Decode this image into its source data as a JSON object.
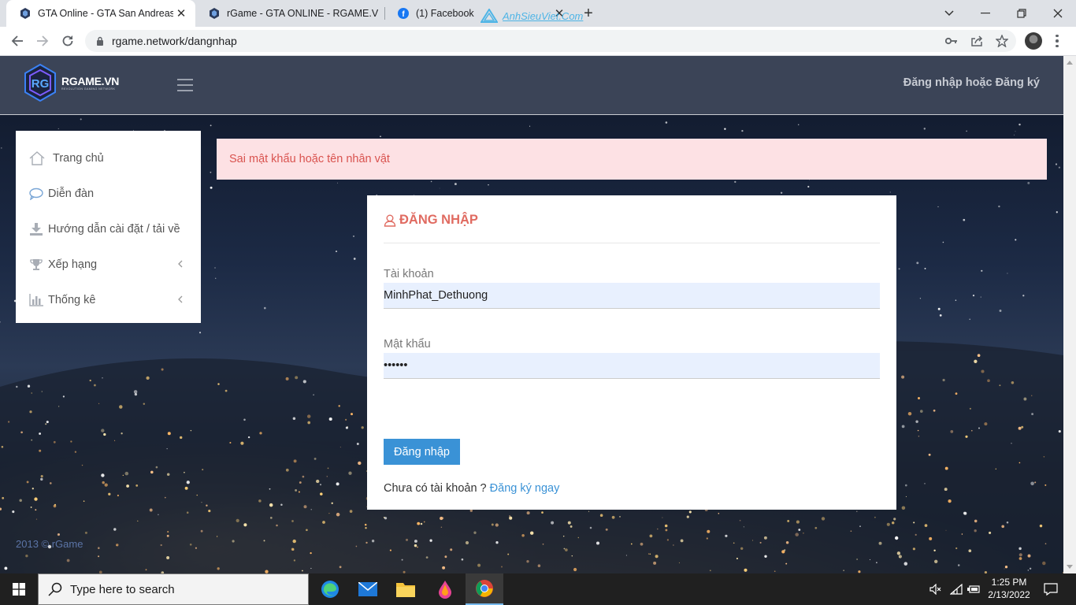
{
  "browser": {
    "tabs": [
      {
        "title": "GTA Online - GTA San Andreas - (",
        "active": true
      },
      {
        "title": "rGame - GTA ONLINE - RGAME.V",
        "active": false
      },
      {
        "title": "(1) Facebook",
        "active": false
      }
    ],
    "watermark": "AnhSieuViet.Com",
    "url": "rgame.network/dangnhap"
  },
  "site": {
    "logo_text": "RGAME.VN",
    "logo_tagline": "REVOLUTION GAMING NETWORK",
    "auth_link": "Đăng nhập hoặc Đăng ký",
    "sidebar": [
      {
        "label": "Trang chủ",
        "icon": "home-icon",
        "has_chevron": false
      },
      {
        "label": "Diễn đàn",
        "icon": "comment-icon",
        "has_chevron": false
      },
      {
        "label": "Hướng dẫn cài đặt / tải về",
        "icon": "download-icon",
        "has_chevron": false
      },
      {
        "label": "Xếp hạng",
        "icon": "trophy-icon",
        "has_chevron": true
      },
      {
        "label": "Thống kê",
        "icon": "bar-chart-icon",
        "has_chevron": true
      }
    ],
    "alert": "Sai mật khẩu hoặc tên nhân vật",
    "login": {
      "title": "ĐĂNG NHẬP",
      "username_label": "Tài khoản",
      "username_value": "MinhPhat_Dethuong",
      "password_label": "Mật khẩu",
      "password_value": "••••••",
      "submit_label": "Đăng nhập",
      "no_account_text": "Chưa có tài khoản ?",
      "signup_link": "Đăng ký ngay"
    },
    "footer": "2013 © rGame"
  },
  "taskbar": {
    "search_placeholder": "Type here to search",
    "time": "1:25 PM",
    "date": "2/13/2022"
  },
  "colors": {
    "accent": "#3a92d6",
    "alert_bg": "#fde1e4",
    "alert_text": "#d9534f",
    "title_red": "#e06b61",
    "header_bg": "#3b4457"
  }
}
